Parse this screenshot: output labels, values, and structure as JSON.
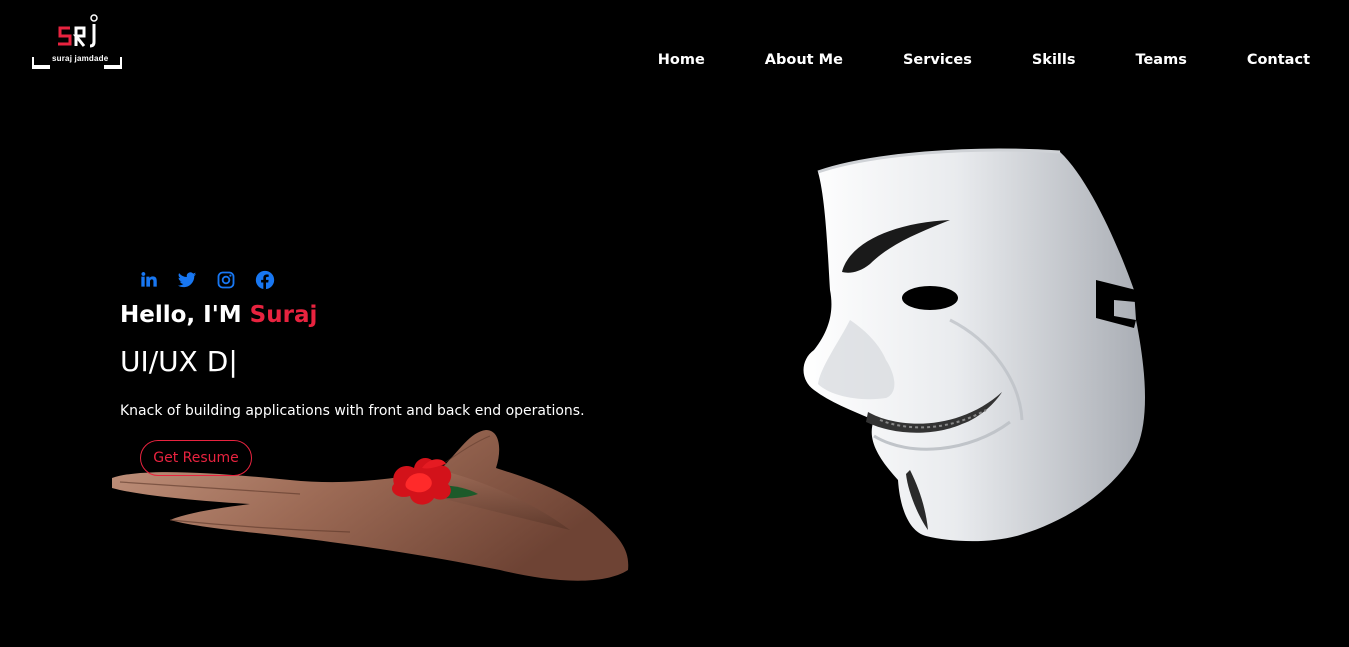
{
  "brand": {
    "logo_letters": "SRJ",
    "caption": "suraj jamdade"
  },
  "nav": {
    "items": [
      {
        "label": "Home"
      },
      {
        "label": "About Me"
      },
      {
        "label": "Services"
      },
      {
        "label": "Skills"
      },
      {
        "label": "Teams"
      },
      {
        "label": "Contact"
      }
    ]
  },
  "hero": {
    "socials": [
      {
        "icon": "linkedin-icon"
      },
      {
        "icon": "twitter-icon"
      },
      {
        "icon": "instagram-icon"
      },
      {
        "icon": "facebook-icon"
      }
    ],
    "greeting": "Hello, I'M",
    "name": "Suraj",
    "role_typed": "UI/UX D",
    "caret": "|",
    "tagline": "Knack of building applications with front and back end operations.",
    "button_label": "Get Resume"
  },
  "colors": {
    "background": "#000000",
    "accent": "#e8233f",
    "social_blue": "#1877f2",
    "text": "#ffffff"
  }
}
